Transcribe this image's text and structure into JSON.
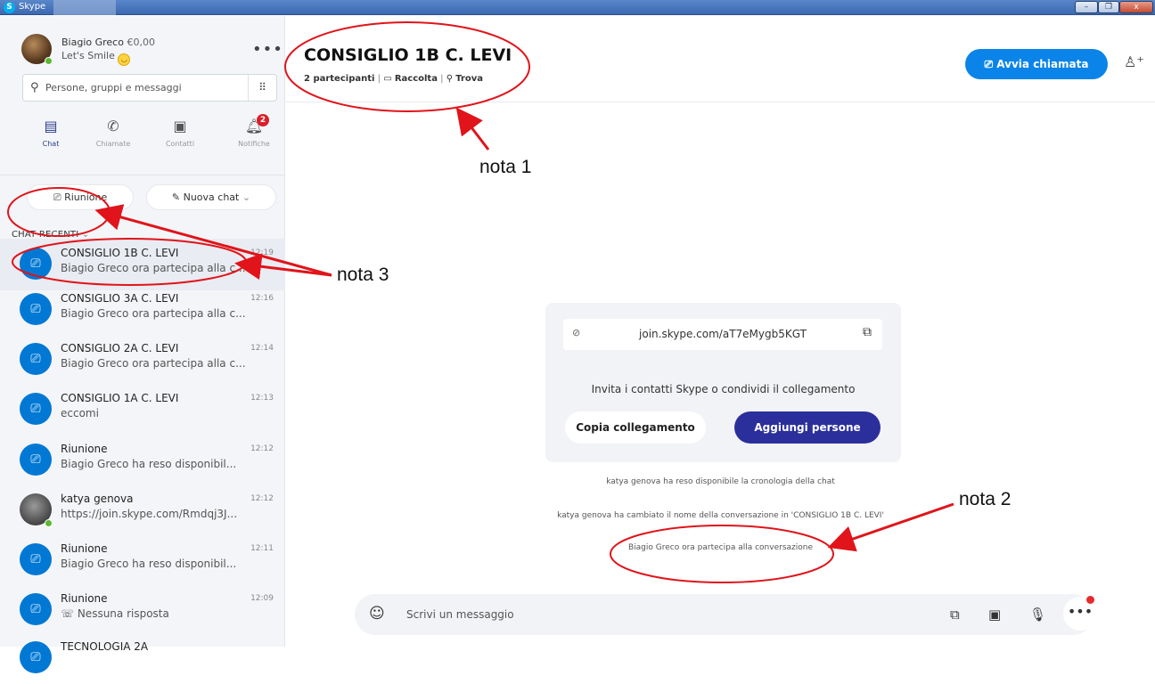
{
  "window": {
    "app_title": "Skype",
    "min": "–",
    "max": "❐",
    "close": "x"
  },
  "profile": {
    "name": "Biagio Greco",
    "credit": "€0,00",
    "mood": "Let's Smile",
    "more_icon": "more-dots"
  },
  "search": {
    "placeholder": "Persone, gruppi e messaggi"
  },
  "nav": [
    {
      "label": "Chat",
      "icon": "chat-icon"
    },
    {
      "label": "Chiamate",
      "icon": "phone-icon"
    },
    {
      "label": "Contatti",
      "icon": "contacts-icon"
    },
    {
      "label": "Notifiche",
      "icon": "bell-icon",
      "badge": "2"
    }
  ],
  "actions": {
    "meeting": "Riunione",
    "new_chat": "Nuova chat"
  },
  "recent_header": "CHAT RECENTI",
  "chats": [
    {
      "name": "CONSIGLIO 1B C. LEVI",
      "time": "12:19",
      "preview": "Biagio Greco ora partecipa alla c...",
      "selected": true
    },
    {
      "name": "CONSIGLIO 3A C. LEVI",
      "time": "12:16",
      "preview": "Biagio Greco ora partecipa alla c..."
    },
    {
      "name": "CONSIGLIO 2A C. LEVI",
      "time": "12:14",
      "preview": "Biagio Greco ora partecipa alla c..."
    },
    {
      "name": "CONSIGLIO 1A C. LEVI",
      "time": "12:13",
      "preview": "eccomi"
    },
    {
      "name": "Riunione",
      "time": "12:12",
      "preview": "Biagio Greco ha reso disponibil..."
    },
    {
      "name": "katya genova",
      "time": "12:12",
      "preview": "https://join.skype.com/Rmdqj3J..."
    },
    {
      "name": "Riunione",
      "time": "12:11",
      "preview": "Biagio Greco ha reso disponibil..."
    },
    {
      "name": "Riunione",
      "time": "12:09",
      "preview": "Nessuna risposta"
    },
    {
      "name": "TECNOLOGIA 2A",
      "time": "",
      "preview": ""
    }
  ],
  "conversation": {
    "title": "CONSIGLIO 1B C. LEVI",
    "participants": "2 partecipanti",
    "gallery": "Raccolta",
    "find": "Trova",
    "call_button": "Avvia chiamata"
  },
  "invite_card": {
    "link": "join.skype.com/aT7eMygb5KGT",
    "text": "Invita i contatti Skype o condividi il collegamento",
    "copy_button": "Copia collegamento",
    "add_button": "Aggiungi persone"
  },
  "system_messages": [
    "katya genova ha reso disponibile la cronologia della chat",
    "katya genova ha cambiato il nome della conversazione in 'CONSIGLIO 1B C. LEVI'",
    "Biagio Greco ora partecipa alla conversazione"
  ],
  "composer": {
    "placeholder": "Scrivi un messaggio"
  },
  "annotations": {
    "note1": "nota 1",
    "note2": "nota 2",
    "note3": "nota 3",
    "color": "#e0141a"
  }
}
